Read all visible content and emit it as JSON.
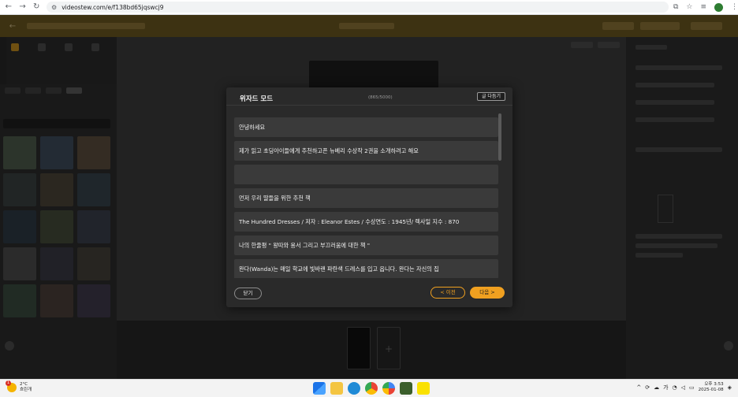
{
  "browser": {
    "url": "videostew.com/e/f138bd65jqswcj9",
    "nav_icons": [
      "back-arrow-icon",
      "forward-arrow-icon",
      "reload-icon"
    ],
    "right_icons": [
      "install-icon",
      "bookmark-star-icon",
      "tab-search-icon",
      "profile-avatar",
      "menu-dots-icon"
    ]
  },
  "modal": {
    "title": "위자드 모드",
    "char_count": "(865/5000)",
    "close_text_button": "글 다듬기",
    "lines": [
      "안녕하세요",
      "제가 읽고 초딩아이들에게 추천하고픈 뉴베리 수상작 2권을 소개하려고 해요",
      "",
      "먼저 우리 딸들을 위한 추천 책",
      "The Hundred Dresses / 저자 : Eleanor Estes / 수상연도 : 1945년/ 렉사일 지수 : 870",
      "나의 한줄평 \" 왕따와 용서 그리고 부끄러움에 대한 책 \"",
      "완다(Wanda)는 매일 학교에 빛바랜 파란색 드레스를 입고 옵니다. 완다는 자신의 집"
    ],
    "close_button": "닫기",
    "prev_button": "< 이전",
    "next_button": "다음 >"
  },
  "colors": {
    "accent": "#f0a020",
    "header": "#6a5620",
    "modal_bg": "#2a2a2a",
    "line_bg": "#3a3a3a"
  },
  "taskbar": {
    "weather_temp": "2°C",
    "weather_desc": "흐린개",
    "weather_badge": "1",
    "tray_lang": "가",
    "time": "오후 3:53",
    "date": "2025-01-08"
  }
}
